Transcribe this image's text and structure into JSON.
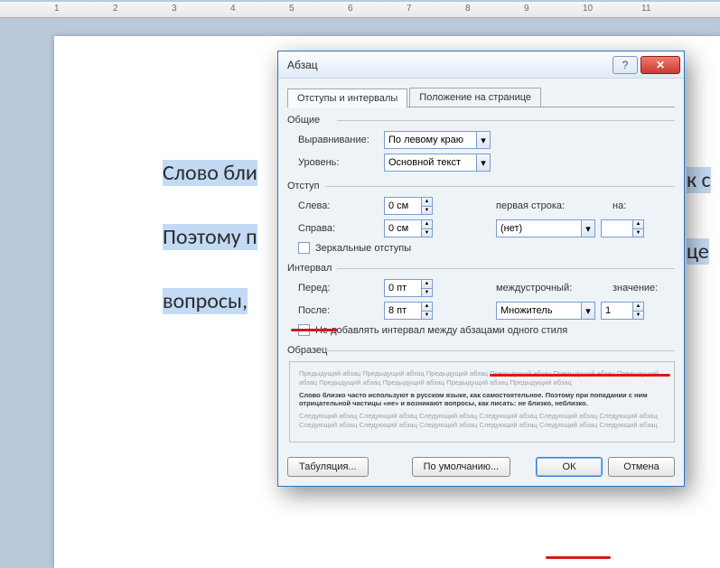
{
  "ruler": {
    "ticks": [
      "1",
      "2",
      "3",
      "4",
      "5",
      "6",
      "7",
      "8",
      "9",
      "10",
      "11"
    ]
  },
  "page": {
    "line1": "Слово бли",
    "line1b": "к с",
    "line2": "Поэтому п",
    "line2b": "це",
    "line3": "вопросы,"
  },
  "dialog": {
    "title": "Абзац",
    "tabs": {
      "indent": "Отступы и интервалы",
      "position": "Положение на странице"
    },
    "groups": {
      "general": {
        "title": "Общие",
        "alignment_label": "Выравнивание:",
        "alignment_value": "По левому краю",
        "level_label": "Уровень:",
        "level_value": "Основной текст"
      },
      "indent": {
        "title": "Отступ",
        "left_label": "Слева:",
        "left_value": "0 см",
        "right_label": "Справа:",
        "right_value": "0 см",
        "firstline_label": "первая строка:",
        "firstline_value": "(нет)",
        "by_label": "на:",
        "by_value": "",
        "mirror_label": "Зеркальные отступы"
      },
      "interval": {
        "title": "Интервал",
        "before_label": "Перед:",
        "before_value": "0 пт",
        "after_label": "После:",
        "after_value": "8 пт",
        "linespacing_label": "междустрочный:",
        "linespacing_value": "Множитель",
        "at_label": "значение:",
        "at_value": "1",
        "nosame_label": "Не добавлять интервал между абзацами одного стиля"
      },
      "sample": {
        "title": "Образец",
        "grey1": "Предыдущий абзац Предыдущий абзац Предыдущий абзац Предыдущий абзац Предыдущий абзац Предыдущий абзац Предыдущий абзац Предыдущий абзац Предыдущий абзац Предыдущий абзац",
        "strong": "Слово близко часто используют в русском языке, как самостоятельное. Поэтому при попадании с ним отрицательной частицы «не» и возникают вопросы, как писать: не близко, неблизко.",
        "grey2": "Следующий абзац Следующий абзац Следующий абзац Следующий абзац Следующий абзац Следующий абзац Следующий абзац Следующий абзац Следующий абзац Следующий абзац Следующий абзац Следующий абзац"
      }
    },
    "buttons": {
      "tabs": "Табуляция...",
      "default": "По умолчанию...",
      "ok": "ОК",
      "cancel": "Отмена"
    }
  }
}
